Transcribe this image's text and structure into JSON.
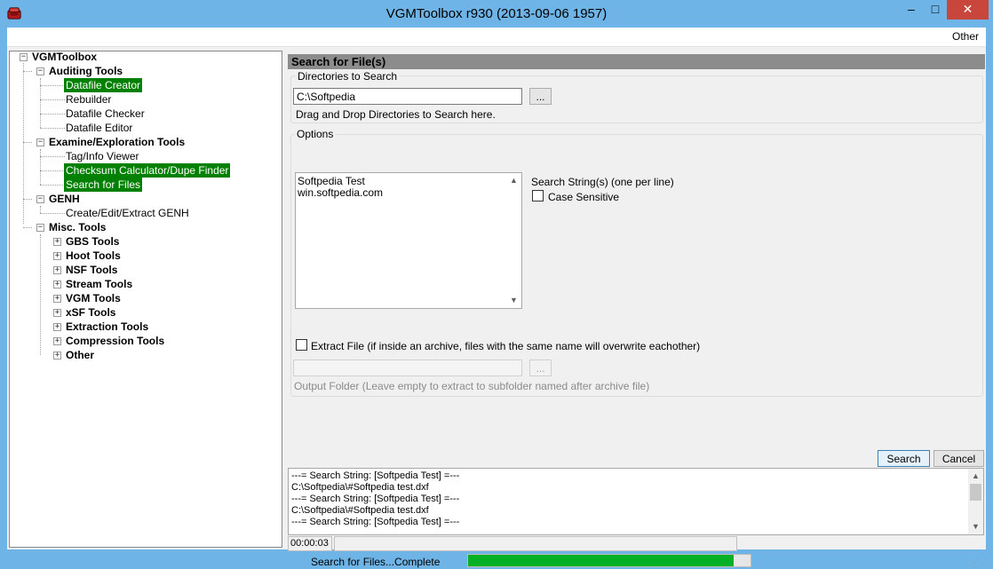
{
  "window": {
    "title": "VGMToolbox r930 (2013-09-06 1957)",
    "minimize_glyph": "–",
    "maximize_glyph": "□",
    "close_glyph": "✕"
  },
  "menu": {
    "other": "Other"
  },
  "tree": {
    "root": "VGMToolbox",
    "auditing": "Auditing Tools",
    "datafile_creator": "Datafile Creator",
    "rebuilder": "Rebuilder",
    "datafile_checker": "Datafile Checker",
    "datafile_editor": "Datafile Editor",
    "examine": "Examine/Exploration Tools",
    "tag_info": "Tag/Info Viewer",
    "checksum": "Checksum Calculator/Dupe Finder",
    "search_files": "Search for Files",
    "genh": "GENH",
    "genh_create": "Create/Edit/Extract GENH",
    "misc": "Misc. Tools",
    "gbs": "GBS Tools",
    "hoot": "Hoot Tools",
    "nsf": "NSF Tools",
    "stream": "Stream Tools",
    "vgm": "VGM Tools",
    "xsf": "xSF Tools",
    "extraction": "Extraction Tools",
    "compression": "Compression Tools",
    "other": "Other"
  },
  "panel": {
    "header": "Search for File(s)",
    "directories_legend": "Directories to Search",
    "directory_value": "C:\\Softpedia",
    "browse_label": "...",
    "drag_drop_hint": "Drag and Drop Directories to Search here.",
    "options_legend": "Options",
    "search_strings": [
      "Softpedia Test",
      "win.softpedia.com"
    ],
    "search_strings_label": "Search String(s) (one per line)",
    "case_sensitive_label": "Case Sensitive",
    "extract_label": "Extract File (if inside an archive, files with the same name will overwrite eachother)",
    "output_browse_label": "...",
    "output_hint": "Output Folder (Leave empty to extract to subfolder named after archive file)",
    "search_button": "Search",
    "cancel_button": "Cancel"
  },
  "log": {
    "lines": [
      "---= Search String: [Softpedia Test] =---",
      "C:\\Softpedia\\#Softpedia test.dxf",
      "---= Search String: [Softpedia Test] =---",
      "C:\\Softpedia\\#Softpedia test.dxf",
      "---= Search String: [Softpedia Test] =---"
    ]
  },
  "timer": "00:00:03",
  "status": {
    "text": "Search for Files...Complete",
    "progress": 0.94
  },
  "colors": {
    "titlebar": "#6fb4e6",
    "selection": "#008000",
    "progress": "#06b025",
    "close": "#c9463d"
  }
}
